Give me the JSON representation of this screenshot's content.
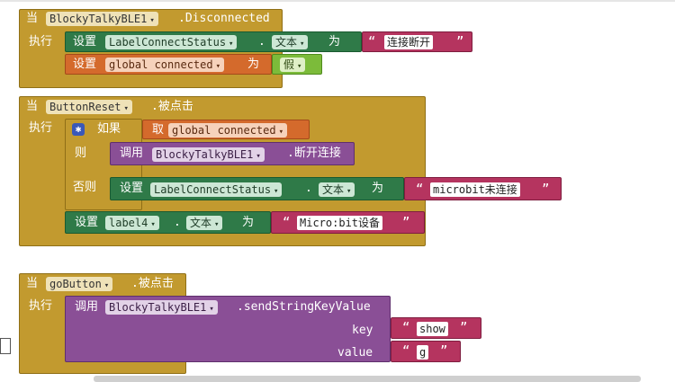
{
  "event1": {
    "when_label": "当",
    "component": "BlockyTalkyBLE1",
    "event_name": ".Disconnected",
    "do_label": "执行",
    "set1": {
      "set_label": "设置",
      "component": "LabelConnectStatus",
      "dot": ".",
      "property": "文本",
      "to_label": "为",
      "text_value": "连接断开"
    },
    "set2": {
      "set_label": "设置",
      "variable": "global connected",
      "to_label": "为",
      "bool_value": "假"
    }
  },
  "event2": {
    "when_label": "当",
    "component": "ButtonReset",
    "event_name": ".被点击",
    "do_label": "执行",
    "if": {
      "if_label": "如果",
      "get_label": "取",
      "variable": "global connected",
      "then_label": "则",
      "else_label": "否则",
      "then_call": {
        "call_label": "调用",
        "component": "BlockyTalkyBLE1",
        "method": ".断开连接"
      },
      "else_set": {
        "set_label": "设置",
        "component": "LabelConnectStatus",
        "dot": ".",
        "property": "文本",
        "to_label": "为",
        "text_value": "microbit未连接"
      }
    },
    "set_after": {
      "set_label": "设置",
      "component": "label4",
      "dot": ".",
      "property": "文本",
      "to_label": "为",
      "text_value": "Micro:bit设备"
    }
  },
  "event3": {
    "when_label": "当",
    "component": "goButton",
    "event_name": ".被点击",
    "do_label": "执行",
    "call": {
      "call_label": "调用",
      "component": "BlockyTalkyBLE1",
      "method": ".sendStringKeyValue",
      "key_label": "key",
      "key_value": "show",
      "value_label": "value",
      "value_value": "g"
    }
  },
  "icons": {
    "dropdown": "▾",
    "quote_open": "“",
    "quote_close": "”",
    "gear": "gear-icon"
  }
}
